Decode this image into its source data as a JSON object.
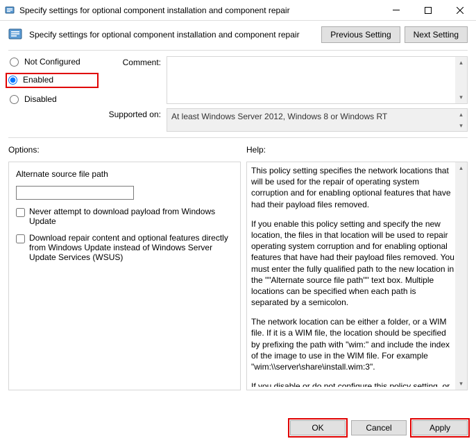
{
  "window": {
    "title": "Specify settings for optional component installation and component repair"
  },
  "header": {
    "desc": "Specify settings for optional component installation and component repair",
    "prev": "Previous Setting",
    "next": "Next Setting"
  },
  "states": {
    "not_configured": "Not Configured",
    "enabled": "Enabled",
    "disabled": "Disabled",
    "selected": "enabled"
  },
  "comment": {
    "label": "Comment:",
    "value": ""
  },
  "supported": {
    "label": "Supported on:",
    "value": "At least Windows Server 2012, Windows 8 or Windows RT"
  },
  "options": {
    "label": "Options:",
    "alt_path_label": "Alternate source file path",
    "alt_path_value": "",
    "cb_never": "Never attempt to download payload from Windows Update",
    "cb_wsus": "Download repair content and optional features directly from Windows Update instead of Windows Server Update Services (WSUS)"
  },
  "help": {
    "label": "Help:",
    "p1": "This policy setting specifies the network locations that will be used for the repair of operating system corruption and for enabling optional features that have had their payload files removed.",
    "p2": "If you enable this policy setting and specify the new location, the files in that location will be used to repair operating system corruption and for enabling optional features that have had their payload files removed. You must enter the fully qualified path to the new location in the \"\"Alternate source file path\"\" text box. Multiple locations can be specified when each path is separated by a semicolon.",
    "p3": "The network location can be either a folder, or a WIM file. If it is a WIM file, the location should be specified by prefixing the path with \"wim:\" and include the index of the image to use in the WIM file. For example \"wim:\\\\server\\share\\install.wim:3\".",
    "p4": "If you disable or do not configure this policy setting, or if the required files cannot be found at the locations specified in this"
  },
  "footer": {
    "ok": "OK",
    "cancel": "Cancel",
    "apply": "Apply"
  }
}
